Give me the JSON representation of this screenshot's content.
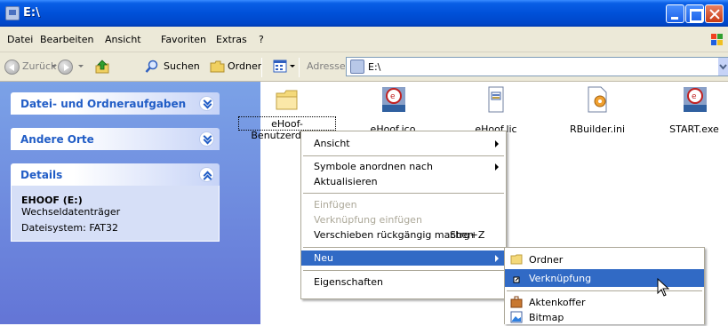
{
  "window": {
    "title": "E:\\"
  },
  "menubar": {
    "items": [
      "Datei",
      "Bearbeiten",
      "Ansicht",
      "Favoriten",
      "Extras",
      "?"
    ]
  },
  "toolbar": {
    "back_label": "Zurück",
    "search_label": "Suchen",
    "folders_label": "Ordner",
    "address_label": "Adresse",
    "address_value": "E:\\"
  },
  "leftpane": {
    "tasks_title": "Datei- und Ordneraufgaben",
    "places_title": "Andere Orte",
    "details_title": "Details",
    "details": {
      "name": "EHOOF (E:)",
      "type": "Wechseldatenträger",
      "filesystem": "Dateisystem: FAT32"
    }
  },
  "files": [
    {
      "name": "eHoof-Benutzerdaten",
      "icon": "folder-icon"
    },
    {
      "name": "eHoof.ico",
      "icon": "ehoof-icon"
    },
    {
      "name": "eHoof.lic",
      "icon": "license-file-icon"
    },
    {
      "name": "RBuilder.ini",
      "icon": "ini-file-icon"
    },
    {
      "name": "START.exe",
      "icon": "ehoof-icon"
    }
  ],
  "context_menu": {
    "items": [
      {
        "label": "Ansicht",
        "submenu": true
      },
      {
        "label": "Symbole anordnen nach",
        "submenu": true
      },
      {
        "label": "Aktualisieren"
      },
      {
        "label": "Einfügen",
        "disabled": true
      },
      {
        "label": "Verknüpfung einfügen",
        "disabled": true
      },
      {
        "label": "Verschieben rückgängig machen",
        "shortcut": "Strg+Z"
      },
      {
        "label": "Neu",
        "submenu": true,
        "highlighted": true
      },
      {
        "label": "Eigenschaften"
      }
    ]
  },
  "submenu_neu": {
    "items": [
      {
        "label": "Ordner",
        "icon": "folder-icon"
      },
      {
        "label": "Verknüpfung",
        "icon": "shortcut-icon",
        "highlighted": true
      },
      {
        "label": "Aktenkoffer",
        "icon": "briefcase-icon"
      },
      {
        "label": "Bitmap",
        "icon": "bitmap-icon"
      }
    ]
  },
  "colors": {
    "titlebar": "#0050d8",
    "highlight": "#316ac5",
    "taskpane": "#6375d6",
    "task_title": "#215dc6"
  }
}
